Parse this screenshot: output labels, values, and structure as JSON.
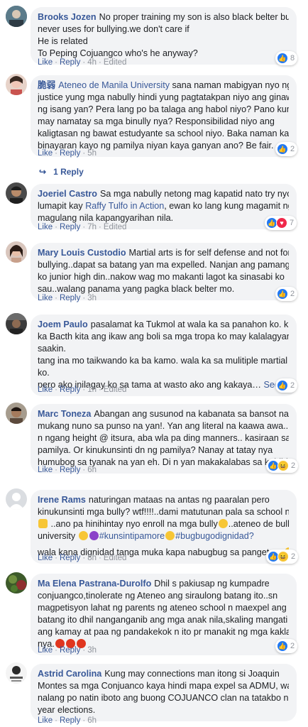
{
  "comments": [
    {
      "author": "Brooks Jozen",
      "lines": [
        "No proper training my son is also black belter but",
        "never uses for bullying.we don't care if",
        "He is related",
        "To Peping Cojuangco who's he anyway?"
      ],
      "like": "Like",
      "reply": "Reply",
      "time": "4h",
      "edited": "Edited",
      "reactions": [
        "like"
      ],
      "reaction_count": "8"
    },
    {
      "author": "脆弱",
      "mention": "Ateneo de Manila University",
      "lines": [
        "sana naman mabigyan nyo ng",
        "justice yung mga nabully hindi yung pagtatakpan niyo ang ginawa",
        "ng isang yan? Pera lang po ba talaga ang habol niyo? Pano kung",
        "may namatay sa mga binully nya? Responsibilidad niyo ang",
        "kaligtasan ng bawat estudyante sa school niyo. Baka naman kasi",
        "binayaran kayo ng pamilya niyan kaya ganyan ano? Be fair."
      ],
      "like": "Like",
      "reply": "Reply",
      "time": "5h",
      "reactions": [
        "like"
      ],
      "reaction_count": "2",
      "replies_label": "1 Reply"
    },
    {
      "author": "Joeriel Castro",
      "mention": "Raffy Tulfo in Action",
      "lines": [
        "Sa mga nabully netong mag kapatid nato try nyo",
        "lumapit kay",
        ", ewan ko lang kung magamit ng",
        "magulang nila kapangyarihan nila."
      ],
      "like": "Like",
      "reply": "Reply",
      "time": "7h",
      "edited": "Edited",
      "reactions": [
        "like",
        "love"
      ],
      "reaction_count": "7"
    },
    {
      "author": "Mary Louis Custodio",
      "lines": [
        "Martial arts is for self defense and not for",
        "bullying..dapat sa batang yan ma expelled. Nanjan ang pamangkin",
        "ko junior high din..nakow wag mo makanti lagot ka sinasabi ko",
        "sau..walang panama yang pagka black belter mo."
      ],
      "like": "Like",
      "reply": "Reply",
      "time": "3h",
      "reactions": [
        "like"
      ],
      "reaction_count": "2"
    },
    {
      "author": "Joem Paulo",
      "lines": [
        "pasalamat ka Tukmol at wala ka sa panahon ko. kung",
        "ka Bacth kita ang ikaw ang boli sa mga tropa ko may kalalagyan ka",
        "saakin.",
        "tang ina mo taikwando ka ba kamo. wala ka sa mulitiple martial art",
        "ko.",
        "pero ako inilagay ko sa tama at wasto ako ang kakaya…"
      ],
      "see_more": "See More",
      "like": "Like",
      "reply": "Reply",
      "time": "1h",
      "edited": "Edited",
      "reactions": [
        "like"
      ],
      "reaction_count": "2"
    },
    {
      "author": "Marc Toneza",
      "lines": [
        "Abangan ang susunod na kabanata sa bansot na",
        "mukang nuno sa punso na yan!. Yan ang literal na kaawa awa.. wla",
        "n ngang height @ itsura, aba wla pa ding manners.. kasiraan sa",
        "pamilya. Or kinukunsinti dn ng pamilya? Nanay at tatay nya",
        "humubog sa tyanak na yan eh. Di n yan makakalabas sa kahihiyan."
      ],
      "like": "Like",
      "reply": "Reply",
      "time": "6h",
      "reactions": [
        "like",
        "haha"
      ],
      "reaction_count": "2"
    },
    {
      "author": "Irene Rams",
      "lines": [
        "naturingan mataas na antas ng paaralan pero",
        "kinukunsinti mga bully? wtf!!!!..dami matutunan pala sa school na to",
        "..ano pa hinihintay nyo enroll na mga bully",
        "..ateneo de bully",
        "university",
        "#kunsintipamore",
        "#bugbugodignidad?",
        "wala kana dignidad tanga muka kapa nabugbug sa panget mo"
      ],
      "like": "Like",
      "reply": "Reply",
      "time": "8h",
      "edited": "Edited",
      "reactions": [
        "like",
        "haha"
      ],
      "reaction_count": "2"
    },
    {
      "author": "Ma Elena Pastrana-Durolfo",
      "lines": [
        "Dhil s pakiusap ng kumpadre",
        "conjuangco,tinolerate ng Ateneo ang siraulong batang ito..sn",
        "magpetisyon lahat ng parents ng ateneo school n maexpel ang",
        "batang ito dhil nanganganib ang mga anak nila,skaling mangati ang",
        "ang kamay at paa ng pandakekok n ito pr manakit ng mga kaklase",
        "nya."
      ],
      "like": "Like",
      "reply": "Reply",
      "time": "3h",
      "reactions": [
        "like"
      ],
      "reaction_count": "2"
    },
    {
      "author": "Astrid Carolina",
      "lines": [
        "Kung may connections man itong si Joaquin",
        "Montes sa mga Conjuanco kaya hindi mapa expel sa ADMU, wag",
        "nalang po natin iboto ang buong COJUANCO clan na tatakbo next",
        "year elections."
      ],
      "like": "Like",
      "reply": "Reply",
      "time": "6h"
    }
  ]
}
